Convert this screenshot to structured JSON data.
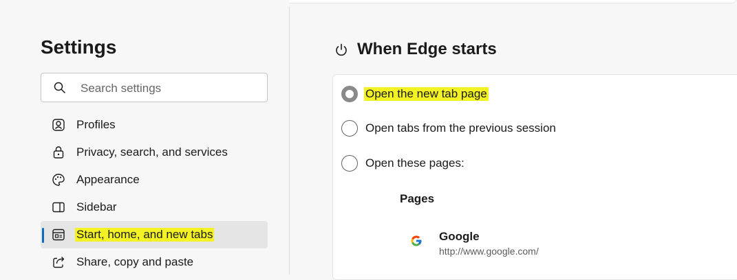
{
  "sidebar": {
    "title": "Settings",
    "search_placeholder": "Search settings",
    "items": [
      {
        "label": "Profiles",
        "icon": "profile-icon"
      },
      {
        "label": "Privacy, search, and services",
        "icon": "lock-icon"
      },
      {
        "label": "Appearance",
        "icon": "palette-icon"
      },
      {
        "label": "Sidebar",
        "icon": "sidebar-icon"
      },
      {
        "label": "Start, home, and new tabs",
        "icon": "home-tabs-icon",
        "selected": true,
        "highlighted": true
      },
      {
        "label": "Share, copy and paste",
        "icon": "share-icon"
      }
    ]
  },
  "main": {
    "section_title": "When Edge starts",
    "section_icon": "power-icon",
    "options": [
      {
        "label": "Open the new tab page",
        "checked": true,
        "highlighted": true
      },
      {
        "label": "Open tabs from the previous session",
        "checked": false
      },
      {
        "label": "Open these pages:",
        "checked": false
      }
    ],
    "pages_heading": "Pages",
    "pages": [
      {
        "name": "Google",
        "url": "http://www.google.com/",
        "icon": "google-icon"
      }
    ]
  },
  "colors": {
    "accent": "#0f6cbd",
    "highlight": "#f3f323"
  }
}
